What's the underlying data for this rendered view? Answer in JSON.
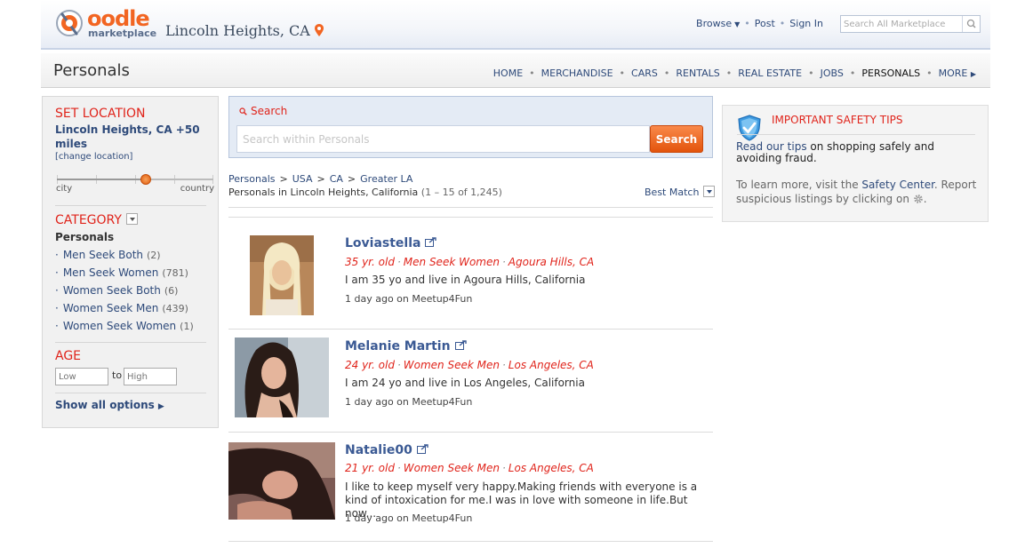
{
  "header": {
    "logo_word": "oodle",
    "logo_sub": "marketplace",
    "location": "Lincoln Heights, CA",
    "nav": {
      "browse": "Browse",
      "post": "Post",
      "signin": "Sign In"
    },
    "search_placeholder": "Search All Marketplace"
  },
  "subheader": {
    "title": "Personals",
    "categories": [
      "HOME",
      "MERCHANDISE",
      "CARS",
      "RENTALS",
      "REAL ESTATE",
      "JOBS",
      "PERSONALS",
      "MORE"
    ]
  },
  "sidebar": {
    "set_location": {
      "heading": "SET LOCATION",
      "value": "Lincoln Heights, CA +50 miles",
      "change": "[change location]",
      "slider_level": 0.57,
      "low_label": "city",
      "high_label": "country"
    },
    "category": {
      "heading": "CATEGORY",
      "current": "Personals",
      "items": [
        {
          "label": "Men Seek Both",
          "count": "(2)"
        },
        {
          "label": "Men Seek Women",
          "count": "(781)"
        },
        {
          "label": "Women Seek Both",
          "count": "(6)"
        },
        {
          "label": "Women Seek Men",
          "count": "(439)"
        },
        {
          "label": "Women Seek Women",
          "count": "(1)"
        }
      ]
    },
    "age": {
      "heading": "AGE",
      "low_placeholder": "Low",
      "to": "to",
      "high_placeholder": "High"
    },
    "show_all": "Show all options"
  },
  "search": {
    "label": "Search",
    "placeholder": "Search within Personals",
    "button": "Search"
  },
  "breadcrumbs": [
    "Personals",
    "USA",
    "CA",
    "Greater LA"
  ],
  "results": {
    "text": "Personals in Lincoln Heights, California",
    "count": "(1 – 15 of 1,245)",
    "sort": "Best Match"
  },
  "listings": [
    {
      "title": "Loviastella",
      "age": "35 yr. old",
      "category": "Men Seek Women",
      "location": "Agoura Hills, CA",
      "description": "I am 35 yo and live in Agoura Hills, California",
      "source": "1 day ago on Meetup4Fun"
    },
    {
      "title": "Melanie Martin",
      "age": "24 yr. old",
      "category": "Women Seek Men",
      "location": "Los Angeles, CA",
      "description": "I am 24 yo and live in Los Angeles, California",
      "source": "1 day ago on Meetup4Fun"
    },
    {
      "title": "Natalie00",
      "age": "21 yr. old",
      "category": "Women Seek Men",
      "location": "Los Angeles, CA",
      "description": "I like to keep myself very happy.Making friends with everyone is a kind of intoxication for me.I was in love with someone in life.But now...",
      "source": "1 day ago on Meetup4Fun"
    }
  ],
  "safety": {
    "heading": "IMPORTANT SAFETY TIPS",
    "line1_link": "Read our tips",
    "line1_rest": " on shopping safely and avoiding fraud.",
    "line2_pre": "To learn more, visit the ",
    "line2_link": "Safety Center",
    "line2_post": ". Report suspicious listings by clicking on ",
    "line2_end": "."
  },
  "colors": {
    "accent_red": "#e0241b",
    "link_blue": "#2e4a7a",
    "brand_orange": "#f26522"
  }
}
